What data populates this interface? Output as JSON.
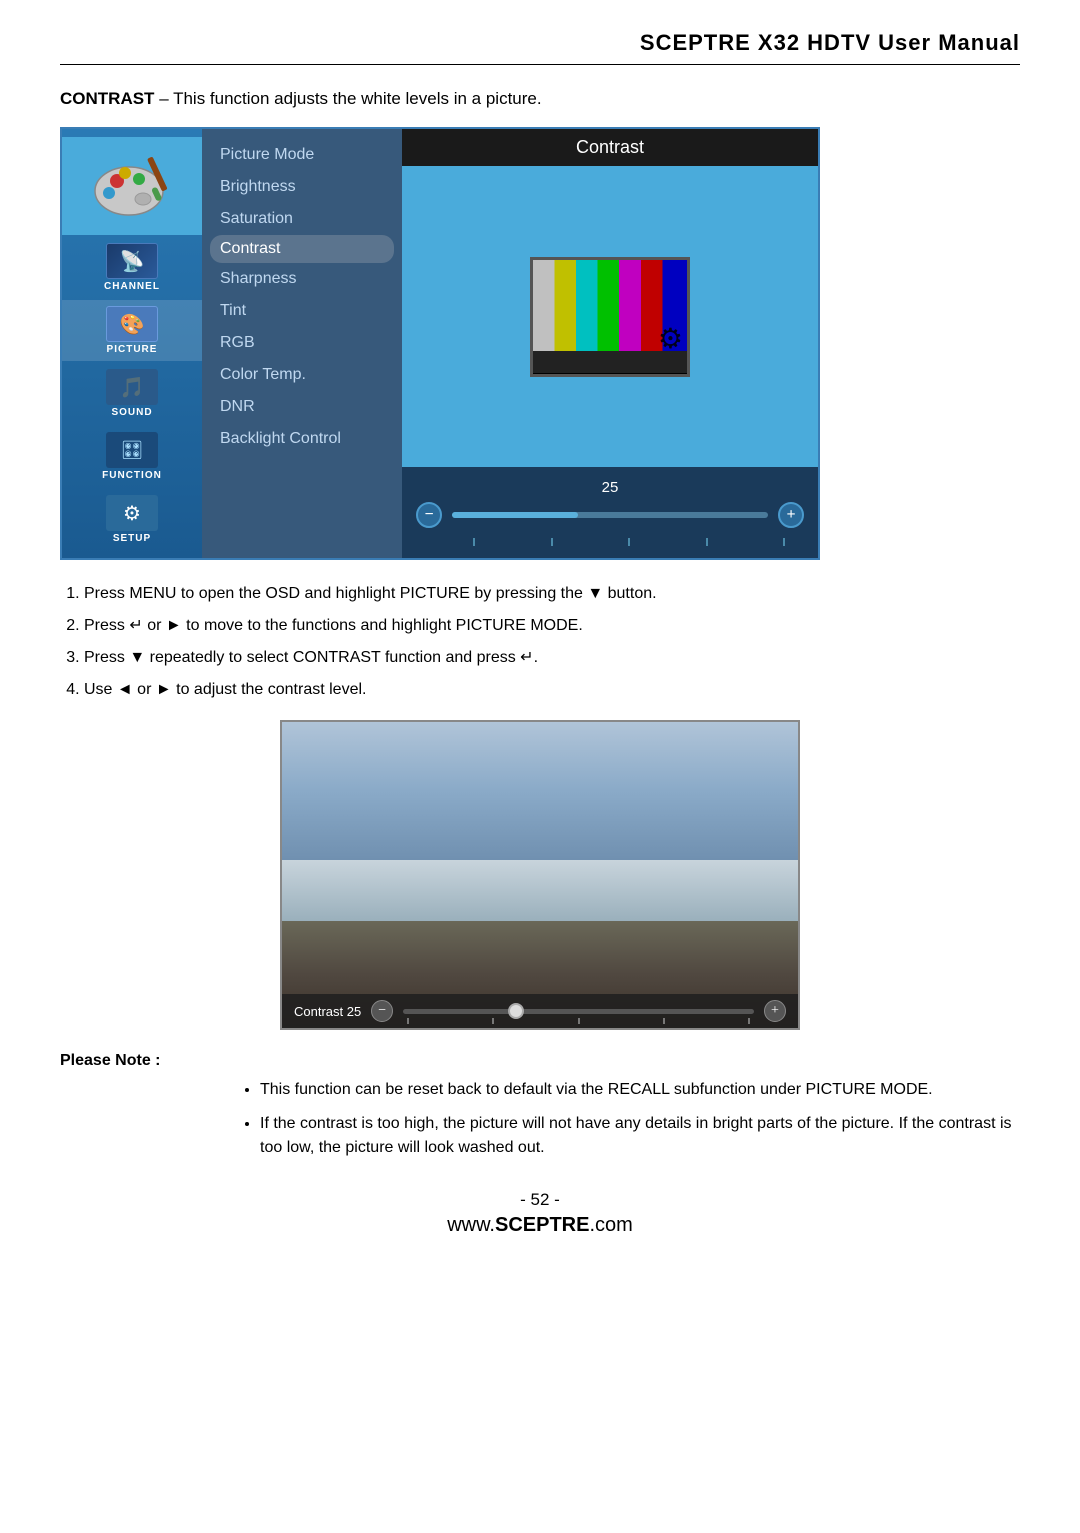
{
  "header": {
    "title": "SCEPTRE X32 HDTV User Manual"
  },
  "intro": {
    "label": "CONTRAST",
    "dash": "–",
    "description": "This function adjusts the white levels in a picture."
  },
  "osd": {
    "sidebar": {
      "items": [
        {
          "id": "channel",
          "label": "CHANNEL",
          "icon": "📺"
        },
        {
          "id": "picture",
          "label": "PICTURE",
          "icon": "🎨"
        },
        {
          "id": "sound",
          "label": "SOUND",
          "icon": "🎵"
        },
        {
          "id": "function",
          "label": "FUNCTION",
          "icon": "🎛"
        },
        {
          "id": "setup",
          "label": "SETUP",
          "icon": "⚙"
        }
      ]
    },
    "menu": {
      "items": [
        {
          "id": "picture-mode",
          "label": "Picture Mode",
          "active": false
        },
        {
          "id": "brightness",
          "label": "Brightness",
          "active": false
        },
        {
          "id": "saturation",
          "label": "Saturation",
          "active": false
        },
        {
          "id": "contrast",
          "label": "Contrast",
          "active": true
        },
        {
          "id": "sharpness",
          "label": "Sharpness",
          "active": false
        },
        {
          "id": "tint",
          "label": "Tint",
          "active": false
        },
        {
          "id": "rgb",
          "label": "RGB",
          "active": false
        },
        {
          "id": "color-temp",
          "label": "Color Temp.",
          "active": false
        },
        {
          "id": "dnr",
          "label": "DNR",
          "active": false
        },
        {
          "id": "backlight",
          "label": "Backlight Control",
          "active": false
        }
      ]
    },
    "right": {
      "header": "Contrast",
      "value": "25",
      "slider_value": "25"
    }
  },
  "instructions": {
    "steps": [
      "Press MENU to open the OSD and highlight PICTURE by pressing the ▼ button.",
      "Press ↵ or ► to move to the functions and highlight PICTURE MODE.",
      "Press ▼ repeatedly to select CONTRAST function and press ↵.",
      "Use ◄ or ► to adjust the contrast level."
    ]
  },
  "contrast_bar": {
    "label": "Contrast",
    "value": "25"
  },
  "please_note": {
    "title": "Please Note :",
    "bullets": [
      "This function can be reset back to default via the RECALL subfunction under PICTURE MODE.",
      "If the contrast is too high, the picture will not have any details in bright parts of the picture.  If the contrast is too low, the picture will look washed out."
    ]
  },
  "footer": {
    "page": "- 52 -",
    "url_prefix": "www.",
    "url_brand": "SCEPTRE",
    "url_suffix": ".com"
  }
}
